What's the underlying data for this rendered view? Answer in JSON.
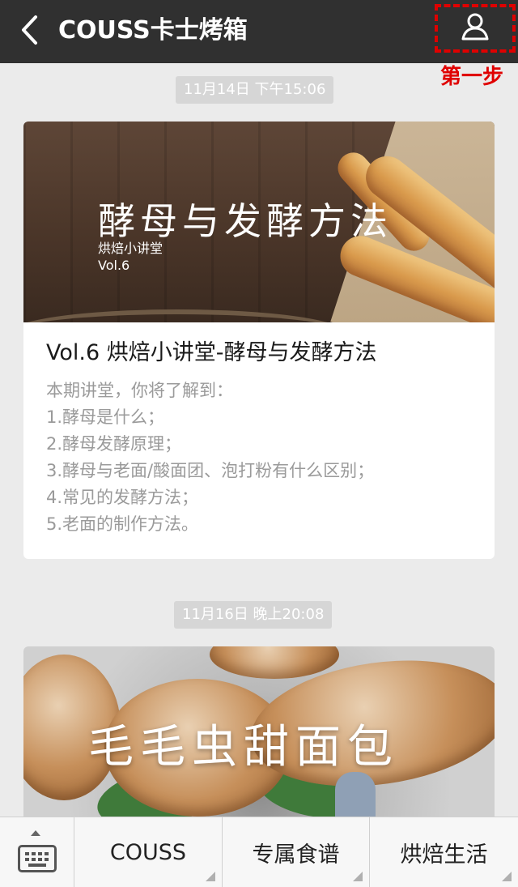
{
  "header": {
    "title": "COUSS卡士烤箱",
    "back_icon": "chevron-left-icon",
    "profile_icon": "person-icon",
    "step_annotation": "第一步",
    "colors": {
      "bar": "#303030",
      "annotation": "#e00000"
    }
  },
  "messages": [
    {
      "timestamp": "11月14日 下午15:06",
      "cover": {
        "title": "酵母与发酵方法",
        "subtitle": "烘焙小讲堂",
        "volume": "Vol.6"
      },
      "title": "Vol.6 烘焙小讲堂-酵母与发酵方法",
      "description": [
        "本期讲堂，你将了解到：",
        "1.酵母是什么；",
        "2.酵母发酵原理；",
        "3.酵母与老面/酸面团、泡打粉有什么区别；",
        "4.常见的发酵方法；",
        "5.老面的制作方法。"
      ]
    },
    {
      "timestamp": "11月16日 晚上20:08",
      "cover": {
        "title": "毛毛虫甜面包"
      }
    }
  ],
  "bottom_menu": {
    "keyboard_icon": "keyboard-icon",
    "items": [
      {
        "label": "COUSS"
      },
      {
        "label": "专属食谱"
      },
      {
        "label": "烘焙生活"
      }
    ]
  }
}
